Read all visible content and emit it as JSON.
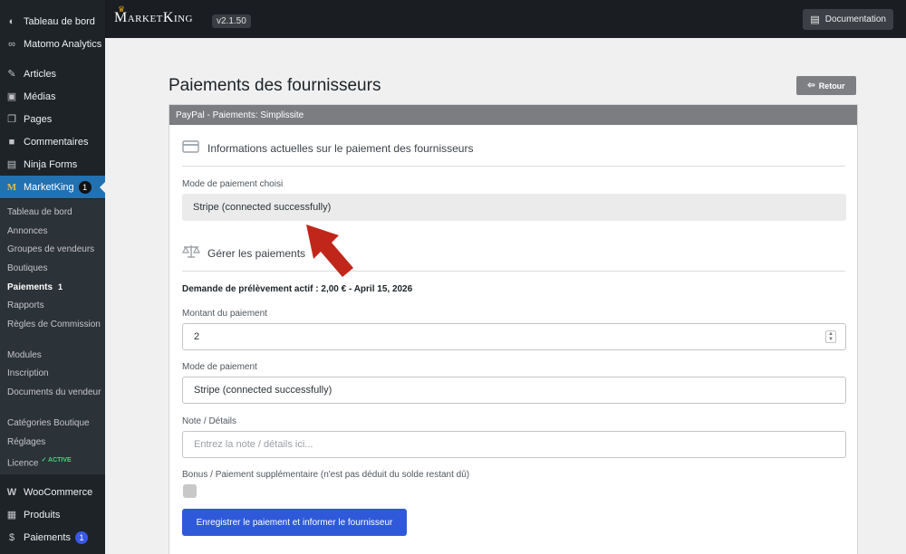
{
  "sidebar": {
    "items_top": [
      {
        "label": "Tableau de bord",
        "icon": "dashboard-icon"
      },
      {
        "label": "Matomo Analytics",
        "icon": "analytics-icon"
      },
      {
        "label": "Articles",
        "icon": "pin-icon"
      },
      {
        "label": "Médias",
        "icon": "media-icon"
      },
      {
        "label": "Pages",
        "icon": "pages-icon"
      },
      {
        "label": "Commentaires",
        "icon": "comment-icon"
      },
      {
        "label": "Ninja Forms",
        "icon": "form-icon"
      },
      {
        "label": "MarketKing",
        "icon": "marketking-icon",
        "count": "1"
      }
    ],
    "submenu": [
      {
        "label": "Tableau de bord"
      },
      {
        "label": "Annonces"
      },
      {
        "label": "Groupes de vendeurs"
      },
      {
        "label": "Boutiques"
      },
      {
        "label": "Paiements",
        "count": "1"
      },
      {
        "label": "Rapports"
      },
      {
        "label": "Règles de Commission"
      },
      {
        "label": "Modules"
      },
      {
        "label": "Inscription"
      },
      {
        "label": "Documents du vendeur"
      },
      {
        "label": "Catégories Boutique"
      },
      {
        "label": "Réglages"
      },
      {
        "label": "Licence",
        "badge": "✓ ACTIVE"
      }
    ],
    "items_bottom": [
      {
        "label": "WooCommerce",
        "icon": "woo-icon"
      },
      {
        "label": "Produits",
        "icon": "products-icon"
      },
      {
        "label": "Paiements",
        "icon": "payments-icon",
        "count": "1"
      }
    ]
  },
  "topbar": {
    "logo": "MarketKing",
    "version": "v2.1.50",
    "doc_label": "Documentation"
  },
  "page": {
    "title": "Paiements des fournisseurs",
    "back_label": "Retour",
    "panel_header": "PayPal - Paiements: Simplissite",
    "section1_title": "Informations actuelles sur le paiement des fournisseurs",
    "chosen_method_label": "Mode de paiement choisi",
    "chosen_method_value": "Stripe (connected successfully)",
    "section2_title": "Gérer les paiements",
    "active_request": "Demande de prélèvement actif : 2,00 € - April 15, 2026",
    "amount_label": "Montant du paiement",
    "amount_value": "2",
    "method_label": "Mode de paiement",
    "method_value": "Stripe (connected successfully)",
    "note_label": "Note / Détails",
    "note_placeholder": "Entrez la note / détails ici...",
    "bonus_label": "Bonus / Paiement supplémentaire (n'est pas déduit du solde restant dû)",
    "submit_label": "Enregistrer le paiement et informer le fournisseur"
  },
  "colors": {
    "accent": "#2e59d9",
    "annotation_arrow": "#c0271a"
  }
}
